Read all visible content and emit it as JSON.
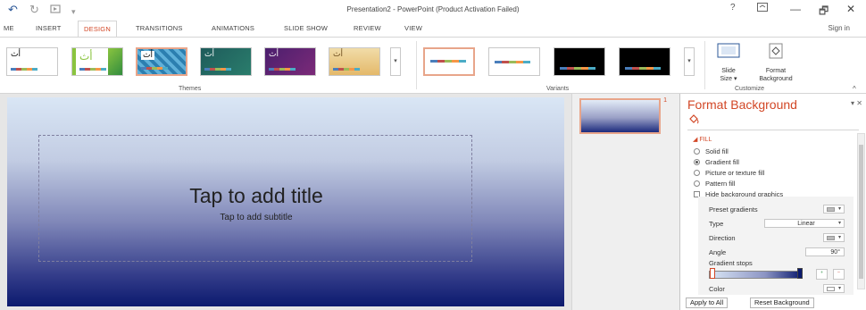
{
  "window": {
    "title": "Presentation2 - PowerPoint (Product Activation Failed)",
    "help": "?",
    "minimize": "—",
    "restore": "🗗",
    "close": "✕"
  },
  "qat": {
    "undo": "↶",
    "redo": "↻"
  },
  "tabs": {
    "home_partial": "ME",
    "insert": "INSERT",
    "design": "DESIGN",
    "transitions": "TRANSITIONS",
    "animations": "ANIMATIONS",
    "slideshow": "SLIDE SHOW",
    "review": "REVIEW",
    "view": "VIEW",
    "signin": "Sign in"
  },
  "ribbon": {
    "themes_label": "Themes",
    "variants_label": "Variants",
    "customize_label": "Customize",
    "theme_sample": "أث",
    "slide_size": "Slide\nSize ▾",
    "format_background": "Format\nBackground",
    "collapse": "^"
  },
  "slide": {
    "title": "Tap to add title",
    "subtitle": "Tap to add subtitle",
    "number": "1"
  },
  "pane": {
    "title": "Format Background",
    "fill_section": "◢ FILL",
    "options": [
      "Solid fill",
      "Gradient fill",
      "Picture or texture fill",
      "Pattern fill"
    ],
    "hide_bg": "Hide background graphics",
    "preset_gradients": "Preset gradients",
    "type_label": "Type",
    "type_value": "Linear",
    "direction_label": "Direction",
    "angle_label": "Angle",
    "angle_value": "90°",
    "gradient_stops": "Gradient stops",
    "color_label": "Color",
    "apply_all": "Apply to All",
    "reset": "Reset Background"
  }
}
